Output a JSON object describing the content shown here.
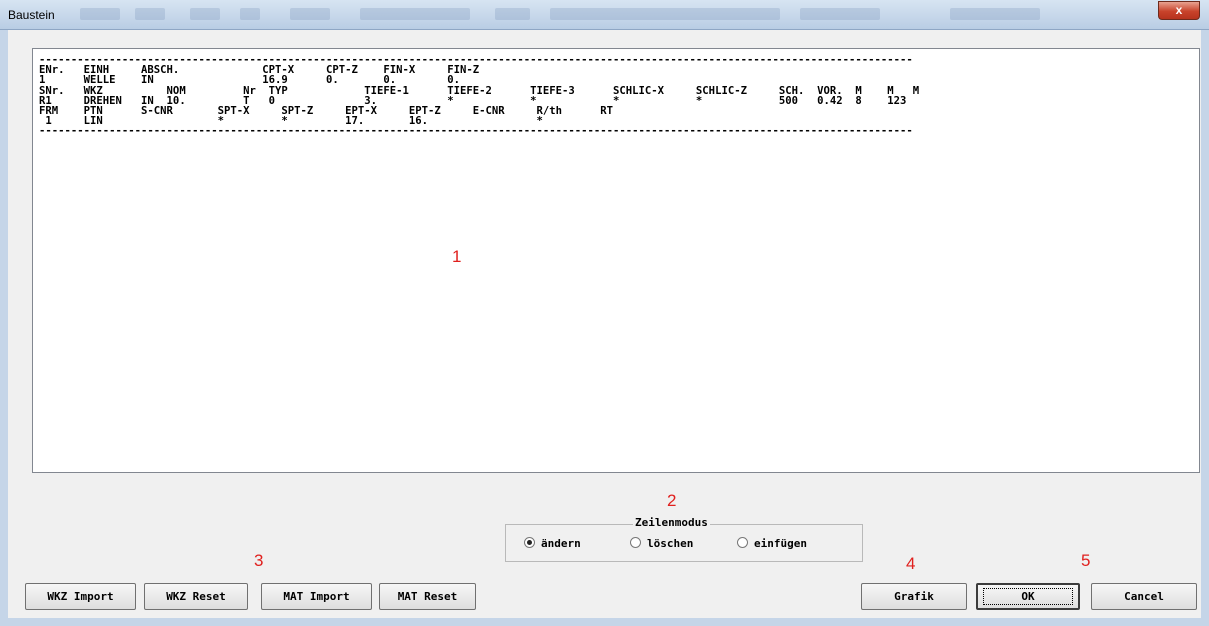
{
  "window": {
    "title": "Baustein",
    "close_label": "x"
  },
  "text_area": {
    "lines": [
      "-----------------------------------------------------------------------------------------------------------------------------------------",
      "ENr.   EINH     ABSCH.             CPT-X     CPT-Z    FIN-X     FIN-Z",
      "1      WELLE    IN                 16.9      0.       0.        0.",
      "SNr.   WKZ          NOM         Nr  TYP            TIEFE-1      TIEFE-2      TIEFE-3      SCHLIC-X     SCHLIC-Z     SCH.  VOR.  M    M   M",
      "R1     DREHEN   IN  10.         T   0              3.           *            *            *            *            500   0.42  8    123",
      "FRM    PTN      S-CNR       SPT-X     SPT-Z     EPT-X     EPT-Z     E-CNR     R/th      RT",
      " 1     LIN                  *         *         17.       16.                 *",
      "-----------------------------------------------------------------------------------------------------------------------------------------"
    ]
  },
  "markers": {
    "m1": "1",
    "m2": "2",
    "m3": "3",
    "m4": "4",
    "m5": "5"
  },
  "zeilenmodus": {
    "label": "Zeilenmodus",
    "options": [
      "ändern",
      "löschen",
      "einfügen"
    ],
    "selected": "ändern"
  },
  "buttons": {
    "wkz_import": "WKZ Import",
    "wkz_reset": "WKZ Reset",
    "mat_import": "MAT Import",
    "mat_reset": "MAT Reset",
    "grafik": "Grafik",
    "ok": "OK",
    "cancel": "Cancel"
  }
}
